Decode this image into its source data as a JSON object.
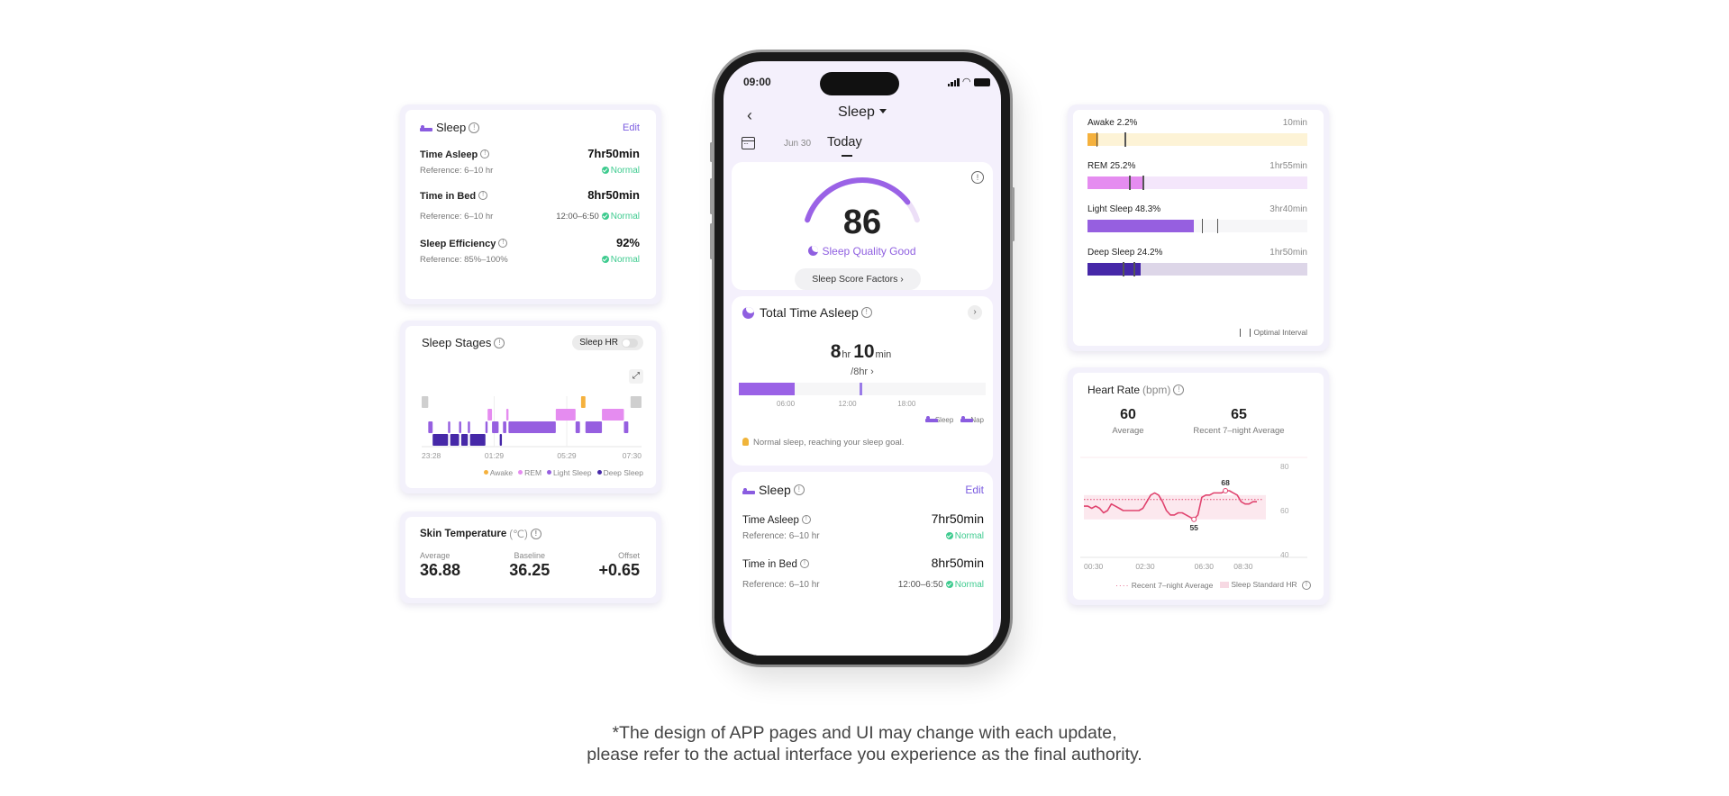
{
  "sleep_summary": {
    "title": "Sleep",
    "edit_label": "Edit",
    "metrics": [
      {
        "label": "Time Asleep",
        "value": "7hr50min",
        "reference": "Reference: 6–10 hr",
        "range": "",
        "status": "Normal"
      },
      {
        "label": "Time in Bed",
        "value": "8hr50min",
        "reference": "Reference: 6–10 hr",
        "range": "12:00–6:50",
        "status": "Normal"
      },
      {
        "label": "Sleep Efficiency",
        "value": "92%",
        "reference": "Reference: 85%–100%",
        "range": "",
        "status": "Normal"
      }
    ]
  },
  "sleep_stages": {
    "title": "Sleep Stages",
    "toggle_label": "Sleep HR",
    "toggle_on": false,
    "expand_icon": "expand-icon",
    "x_labels": [
      "23:28",
      "01:29",
      "05:29",
      "07:30"
    ],
    "legend": [
      {
        "label": "Awake",
        "color": "#f5b13d"
      },
      {
        "label": "REM",
        "color": "#e58cf0"
      },
      {
        "label": "Light Sleep",
        "color": "#965fe0"
      },
      {
        "label": "Deep Sleep",
        "color": "#4628a8"
      }
    ],
    "segments": [
      {
        "stage": "gap",
        "start": 0.0,
        "end": 0.03
      },
      {
        "stage": "light",
        "start": 0.03,
        "end": 0.05
      },
      {
        "stage": "deep",
        "start": 0.05,
        "end": 0.12
      },
      {
        "stage": "light",
        "start": 0.12,
        "end": 0.13
      },
      {
        "stage": "deep",
        "start": 0.13,
        "end": 0.17
      },
      {
        "stage": "light",
        "start": 0.17,
        "end": 0.18
      },
      {
        "stage": "deep",
        "start": 0.18,
        "end": 0.21
      },
      {
        "stage": "light",
        "start": 0.21,
        "end": 0.22
      },
      {
        "stage": "deep",
        "start": 0.22,
        "end": 0.29
      },
      {
        "stage": "light",
        "start": 0.29,
        "end": 0.3
      },
      {
        "stage": "rem",
        "start": 0.3,
        "end": 0.32
      },
      {
        "stage": "light",
        "start": 0.32,
        "end": 0.35
      },
      {
        "stage": "deep",
        "start": 0.355,
        "end": 0.365
      },
      {
        "stage": "light",
        "start": 0.37,
        "end": 0.385
      },
      {
        "stage": "rem",
        "start": 0.385,
        "end": 0.395
      },
      {
        "stage": "light",
        "start": 0.395,
        "end": 0.61
      },
      {
        "stage": "rem",
        "start": 0.61,
        "end": 0.7
      },
      {
        "stage": "light",
        "start": 0.7,
        "end": 0.72
      },
      {
        "stage": "awake",
        "start": 0.725,
        "end": 0.745
      },
      {
        "stage": "light",
        "start": 0.745,
        "end": 0.82
      },
      {
        "stage": "rem",
        "start": 0.82,
        "end": 0.92
      },
      {
        "stage": "light",
        "start": 0.92,
        "end": 0.94
      },
      {
        "stage": "gap",
        "start": 0.95,
        "end": 1.0
      }
    ]
  },
  "skin_temperature": {
    "title": "Skin Temperature",
    "unit": "(℃)",
    "stats": [
      {
        "label": "Average",
        "value": "36.88"
      },
      {
        "label": "Baseline",
        "value": "36.25"
      },
      {
        "label": "Offset",
        "value": "+0.65"
      }
    ]
  },
  "stage_distribution": {
    "items": [
      {
        "label": "Awake 2.2%",
        "duration": "10min",
        "percent": 2.2,
        "color": "#f5b13d",
        "track": "#fdf3d6",
        "optimal": [
          0.04,
          0.17
        ]
      },
      {
        "label": "REM 25.2%",
        "duration": "1hr55min",
        "percent": 25.2,
        "color": "#e58cf0",
        "track": "#f4e6fb",
        "optimal": [
          0.19,
          0.25
        ]
      },
      {
        "label": "Light Sleep 48.3%",
        "duration": "3hr40min",
        "percent": 48.3,
        "color": "#965fe0",
        "track": "#f6f6f8",
        "optimal": [
          0.52,
          0.59
        ]
      },
      {
        "label": "Deep Sleep 24.2%",
        "duration": "1hr50min",
        "percent": 24.2,
        "color": "#4628a8",
        "track": "#ddd6e8",
        "optimal": [
          0.16,
          0.21
        ]
      }
    ],
    "optimal_legend": "Optimal Interval"
  },
  "heart_rate": {
    "title": "Heart Rate",
    "unit": "(bpm)",
    "average_value": "60",
    "average_label": "Average",
    "recent_value": "65",
    "recent_label": "Recent 7–night Average",
    "legend_recent": "Recent 7–night Average",
    "legend_standard": "Sleep Standard HR",
    "chart_data": {
      "type": "line",
      "x_labels": [
        "00:30",
        "02:30",
        "06:30",
        "08:30"
      ],
      "y_ticks": [
        80,
        60,
        40
      ],
      "ylim": [
        40,
        80
      ],
      "recent_average": 65,
      "standard_band": [
        56,
        67
      ],
      "max_label": "68",
      "min_label": "55",
      "values": [
        62,
        62,
        61,
        62,
        61,
        59,
        60,
        63,
        62,
        61,
        60,
        60,
        60,
        60,
        60,
        61,
        64,
        67,
        68,
        67,
        64,
        60,
        58,
        58,
        59,
        59,
        58,
        57,
        56,
        58,
        66,
        67,
        67,
        68,
        68,
        68,
        69,
        69,
        68,
        67,
        64,
        63,
        63,
        64,
        64
      ]
    }
  },
  "phone": {
    "time": "09:00",
    "nav_title": "Sleep",
    "date_prev": "Jun 30",
    "date_current": "Today",
    "score": {
      "value": "86",
      "fraction": 0.86,
      "quality_label": "Sleep Quality Good",
      "factors_button": "Sleep Score Factors"
    },
    "total_time": {
      "title": "Total Time Asleep",
      "hours": "8",
      "hours_unit": "hr",
      "minutes": "10",
      "minutes_unit": "min",
      "goal": "/8hr",
      "x_ticks": [
        "06:00",
        "12:00",
        "18:00"
      ],
      "legend_sleep": "Sleep",
      "legend_nap": "Nap",
      "tip": "Normal sleep, reaching your sleep goal."
    },
    "sleep_card": {
      "title": "Sleep",
      "edit_label": "Edit",
      "metrics": [
        {
          "label": "Time Asleep",
          "value": "7hr50min",
          "reference": "Reference: 6–10 hr",
          "range": "",
          "status": "Normal"
        },
        {
          "label": "Time in Bed",
          "value": "8hr50min",
          "reference": "Reference: 6–10 hr",
          "range": "12:00–6:50",
          "status": "Normal"
        }
      ]
    }
  },
  "disclaimer": {
    "line1": "*The design of APP pages and UI may change with each update,",
    "line2": "please refer to the actual interface you experience as the final authority."
  }
}
